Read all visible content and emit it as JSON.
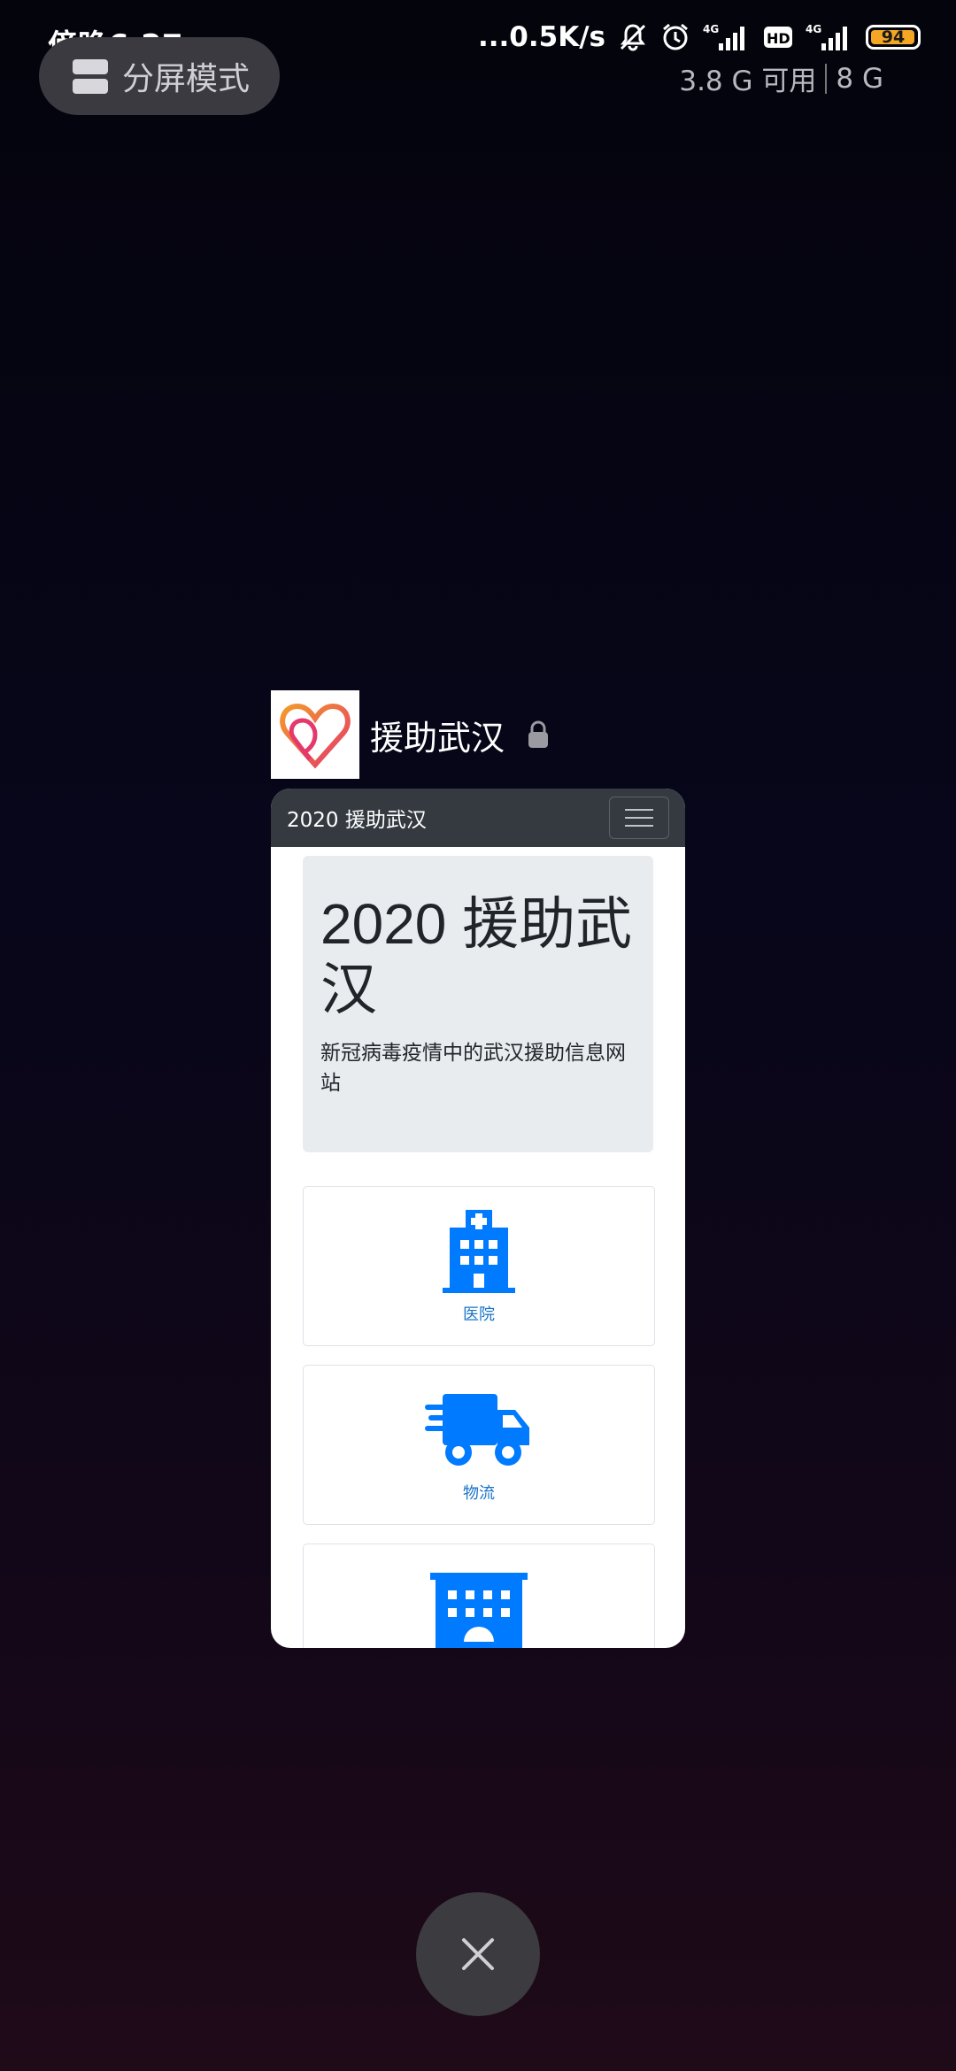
{
  "status_bar": {
    "time": "傍晚6:27",
    "net_speed": "...0.5K/s",
    "battery": "94",
    "net1": "4G",
    "hd": "HD",
    "net2": "4G"
  },
  "memory": {
    "available": "3.8 G 可用",
    "total": "8 G"
  },
  "split_screen": {
    "label": "分屏模式"
  },
  "app": {
    "name": "援助武汉"
  },
  "preview": {
    "brand": "2020 援助武汉",
    "jumbotron_title": "2020 援助武汉",
    "jumbotron_text": "新冠病毒疫情中的武汉援助信息网站",
    "tiles": [
      {
        "label": "医院",
        "icon": "hospital-icon"
      },
      {
        "label": "物流",
        "icon": "truck-icon"
      },
      {
        "label": "",
        "icon": "hotel-icon"
      }
    ]
  },
  "colors": {
    "accent": "#007bff",
    "navbar": "#343a40",
    "jumbotron": "#e9ecef",
    "battery": "#f5a623"
  }
}
